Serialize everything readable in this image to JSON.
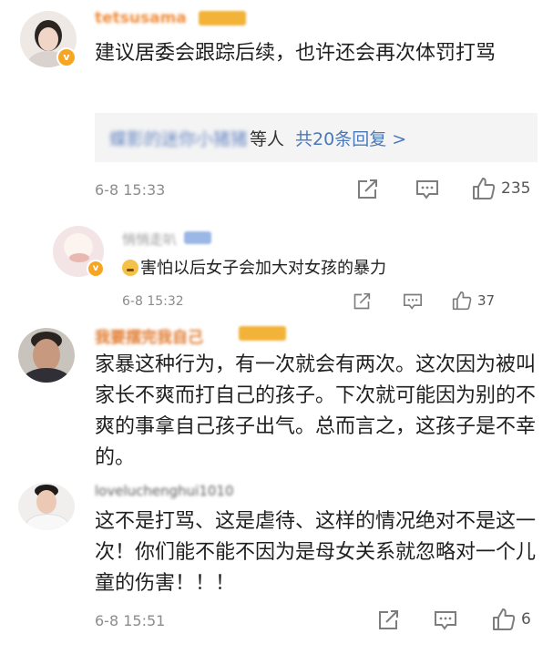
{
  "comments": [
    {
      "username": "tetsusama",
      "text": "建议居委会跟踪后续，也许还会再次体罚打骂",
      "reply_summary": {
        "names": "蝶影的迷你小猪猪",
        "suffix": "等人",
        "link": "共20条回复 >"
      },
      "time": "6-8 15:33",
      "likes": "235"
    },
    {
      "username": "悄悄走叭",
      "text": "害怕以后女子会加大对女孩的暴力",
      "time": "6-8 15:32",
      "likes": "37"
    },
    {
      "username": "我要摆完我自己",
      "text": "家暴这种行为，有一次就会有两次。这次因为被叫家长不爽而打自己的孩子。下次就可能因为别的不爽的事拿自己孩子出气。总而言之，这孩子是不幸的。"
    },
    {
      "username": "loveluchenghui1010",
      "text": "这不是打骂、这是虐待、这样的情况绝对不是这一次！你们能不能不因为是母女关系就忽略对一个儿童的伤害！！！",
      "time": "6-8 15:51",
      "likes": "6"
    }
  ],
  "colors": {
    "username_orange": "#f08c3a",
    "link_blue": "#4a78b8",
    "meta_gray": "#8c8c8c",
    "reply_bg": "#f4f4f4",
    "verified_badge": "#f6a623"
  },
  "icons": {
    "share": "share-icon",
    "comment": "comment-icon",
    "like": "thumbs-up-icon",
    "verified": "verified-badge-icon",
    "emoji": "crying-emoji-icon"
  }
}
